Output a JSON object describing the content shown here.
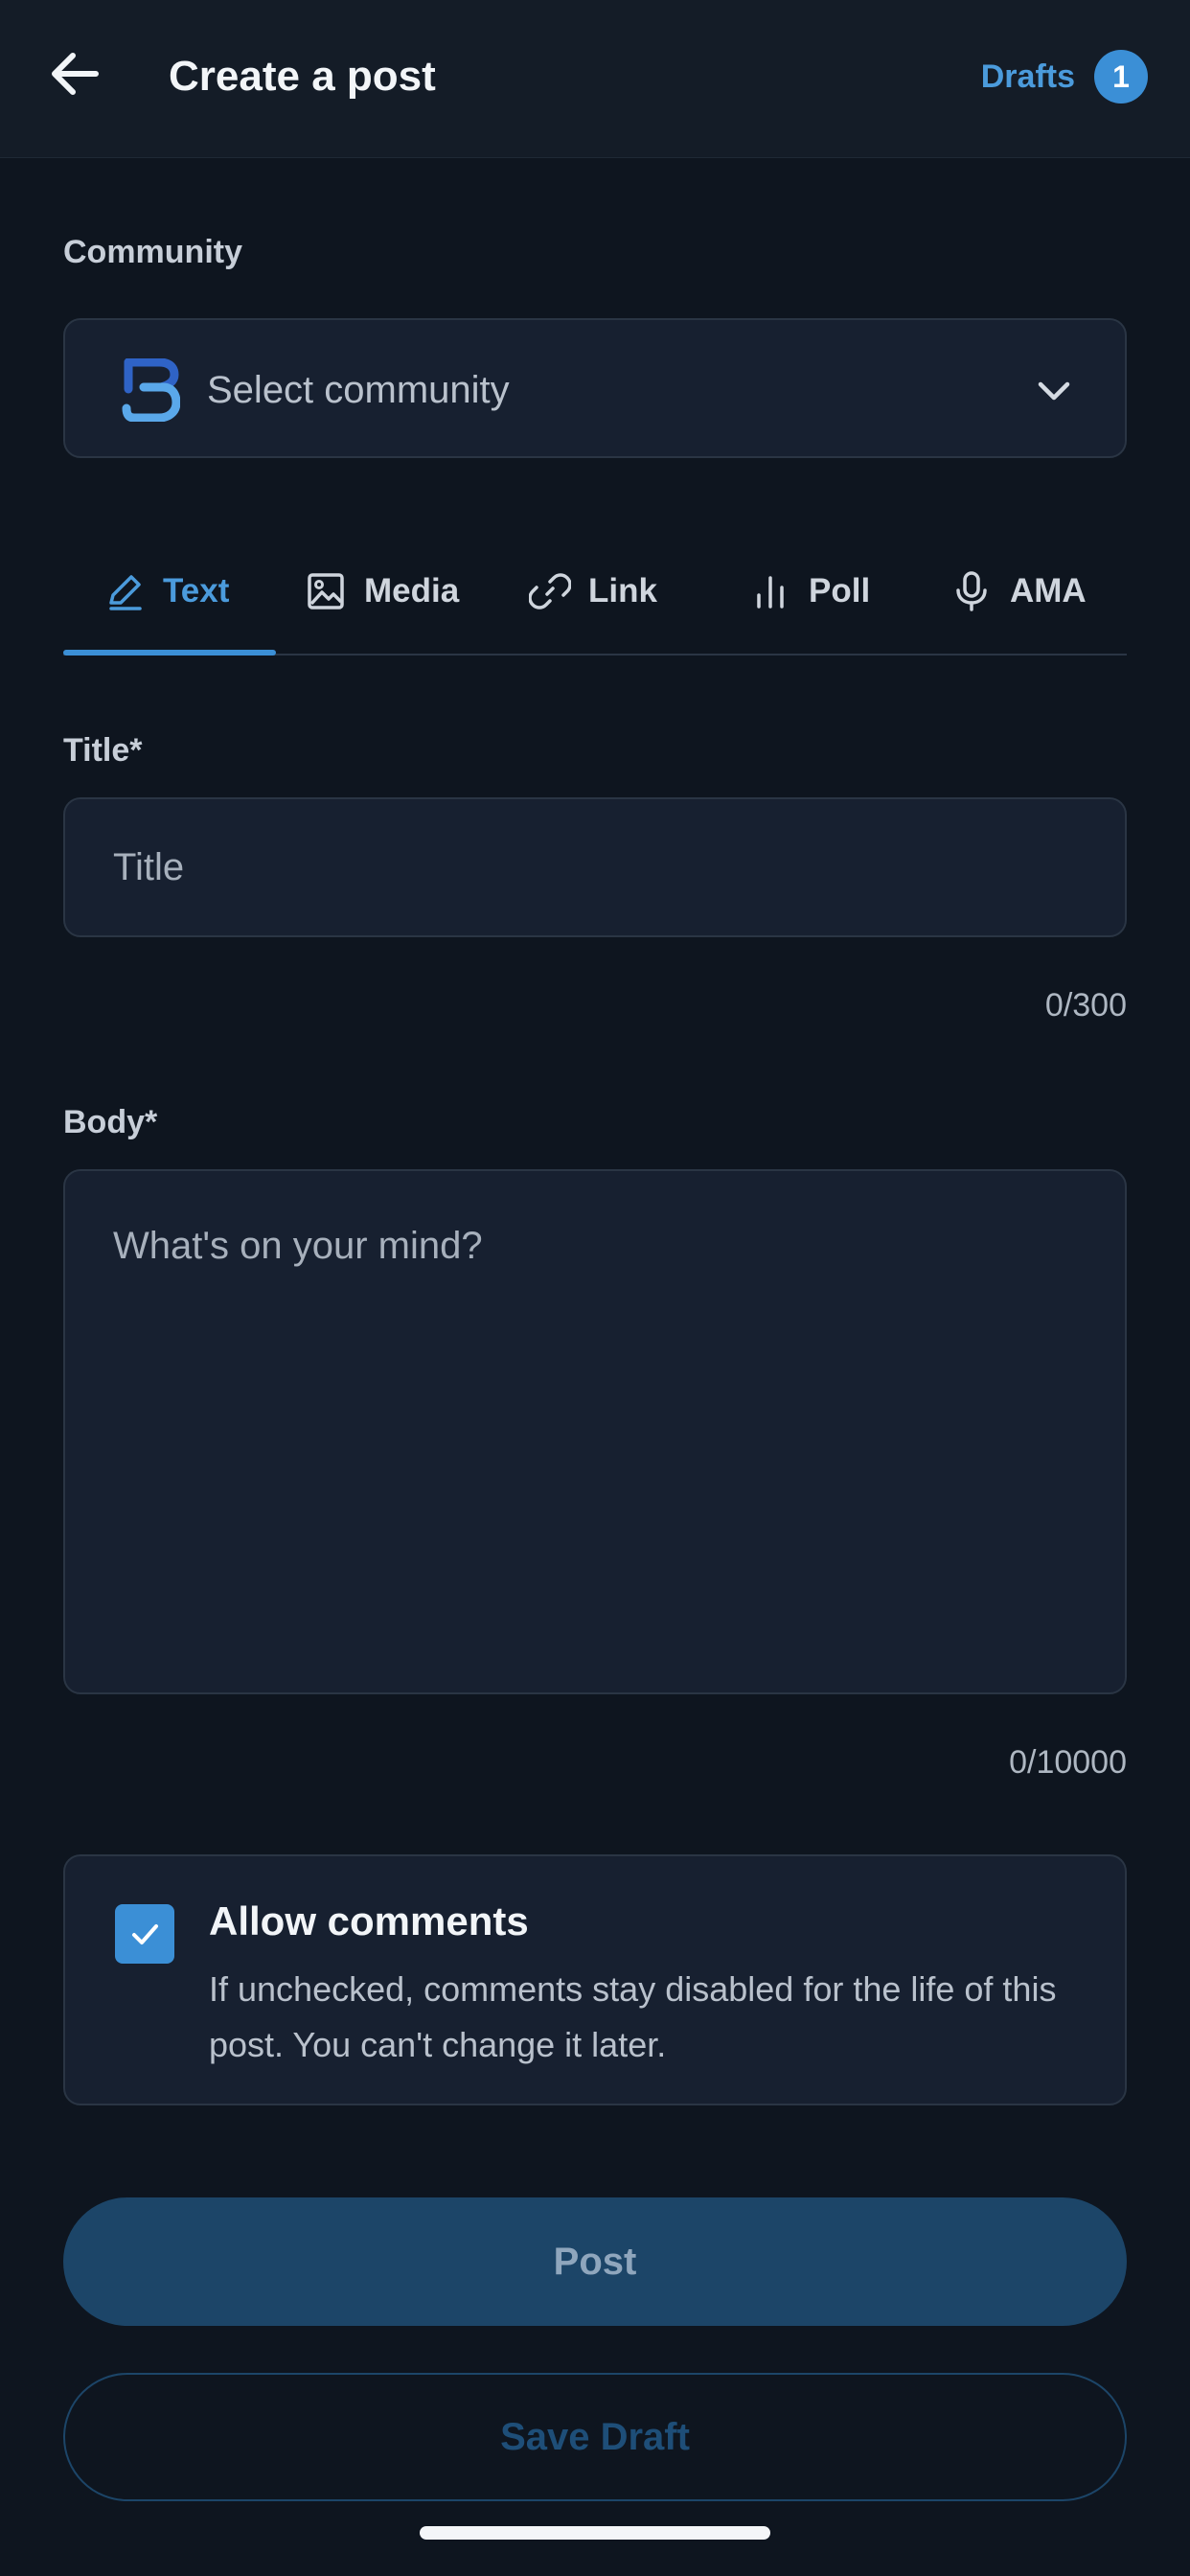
{
  "header": {
    "title": "Create a post",
    "drafts_label": "Drafts",
    "drafts_count": "1"
  },
  "community": {
    "label": "Community",
    "placeholder": "Select community"
  },
  "tabs": [
    {
      "label": "Text",
      "icon": "pencil-icon",
      "active": true
    },
    {
      "label": "Media",
      "icon": "image-icon",
      "active": false
    },
    {
      "label": "Link",
      "icon": "link-icon",
      "active": false
    },
    {
      "label": "Poll",
      "icon": "poll-icon",
      "active": false
    },
    {
      "label": "AMA",
      "icon": "microphone-icon",
      "active": false
    }
  ],
  "title_field": {
    "label": "Title*",
    "placeholder": "Title",
    "value": "",
    "counter": "0/300"
  },
  "body_field": {
    "label": "Body*",
    "placeholder": "What's on your mind?",
    "value": "",
    "counter": "0/10000"
  },
  "comments": {
    "checked": true,
    "title": "Allow comments",
    "description": "If unchecked, comments stay disabled for the life of this post. You can't change it later."
  },
  "actions": {
    "post_label": "Post",
    "save_draft_label": "Save Draft"
  },
  "colors": {
    "background": "#0e151f",
    "header": "#141c27",
    "accent": "#3b8fd6",
    "field": "#172030",
    "post_button": "#1c4568"
  }
}
